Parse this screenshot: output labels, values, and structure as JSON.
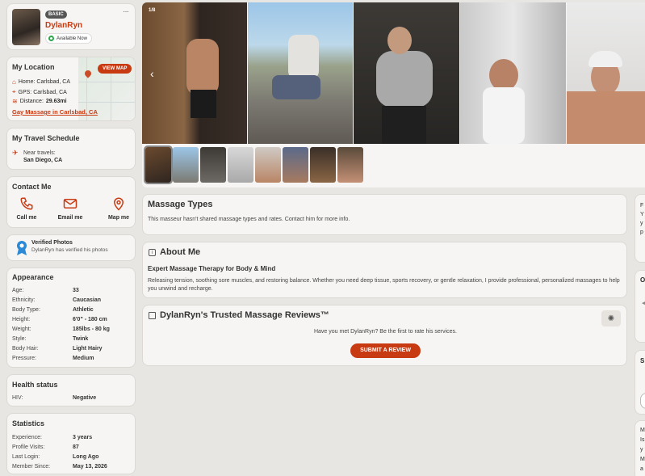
{
  "profile": {
    "badge": "BASIC",
    "name": "DylanRyn",
    "status": "Available Now",
    "more_label": "···"
  },
  "location": {
    "title": "My Location",
    "view_map": "VIEW MAP",
    "home": "Home: Carlsbad, CA",
    "gps": "GPS: Carlsbad, CA",
    "distance_label": "Distance:",
    "distance_value": "29.63mi",
    "link": "Gay Massage in Carlsbad, CA"
  },
  "travel": {
    "title": "My Travel Schedule",
    "near_label": "Near travels:",
    "near_value": "San Diego, CA"
  },
  "contact": {
    "title": "Contact Me",
    "call": "Call me",
    "email": "Email me",
    "map": "Map me"
  },
  "verified": {
    "title": "Verified Photos",
    "subtitle": "DylanRyn has verified his photos"
  },
  "appearance": {
    "title": "Appearance",
    "rows": [
      {
        "k": "Age:",
        "v": "33"
      },
      {
        "k": "Ethnicity:",
        "v": "Caucasian"
      },
      {
        "k": "Body Type:",
        "v": "Athletic"
      },
      {
        "k": "Height:",
        "v": "6'0\" - 180 cm"
      },
      {
        "k": "Weight:",
        "v": "185lbs - 80 kg"
      },
      {
        "k": "Style:",
        "v": "Twink"
      },
      {
        "k": "Body Hair:",
        "v": "Light Hairy"
      },
      {
        "k": "Pressure:",
        "v": "Medium"
      }
    ]
  },
  "health": {
    "title": "Health status",
    "rows": [
      {
        "k": "HIV:",
        "v": "Negative"
      }
    ]
  },
  "stats": {
    "title": "Statistics",
    "rows": [
      {
        "k": "Experience:",
        "v": "3 years"
      },
      {
        "k": "Profile Visits:",
        "v": "87"
      },
      {
        "k": "Last Login:",
        "v": "Long Ago"
      },
      {
        "k": "Member Since:",
        "v": "May 13, 2026"
      }
    ]
  },
  "gallery": {
    "counter": "1/8",
    "prev_arrow": "‹"
  },
  "massage_types": {
    "title": "Massage Types",
    "text": "This masseur hasn't shared massage types and rates. Contact him for more info."
  },
  "about": {
    "title": "About Me",
    "headline": "Expert Massage Therapy for Body & Mind",
    "text": "Releasing tension, soothing sore muscles, and restoring balance. Whether you need deep tissue, sports recovery, or gentle relaxation, I provide professional, personalized massages to help you unwind and recharge."
  },
  "reviews": {
    "title": "DylanRyn's Trusted Massage Reviews™",
    "prompt": "Have you met DylanRyn? Be the first to rate his services.",
    "submit": "SUBMIT A REVIEW"
  },
  "right_col": {
    "c1_lines": [
      "F",
      "Y",
      "y",
      "p"
    ],
    "c2_lines": [
      "O"
    ],
    "c3_lines": [
      "S"
    ],
    "c4_lines": [
      "M",
      "Is",
      "y",
      "M",
      "a"
    ]
  },
  "colors": {
    "accent": "#c83a12",
    "background": "#e8e6e3",
    "card": "#f6f5f3"
  }
}
